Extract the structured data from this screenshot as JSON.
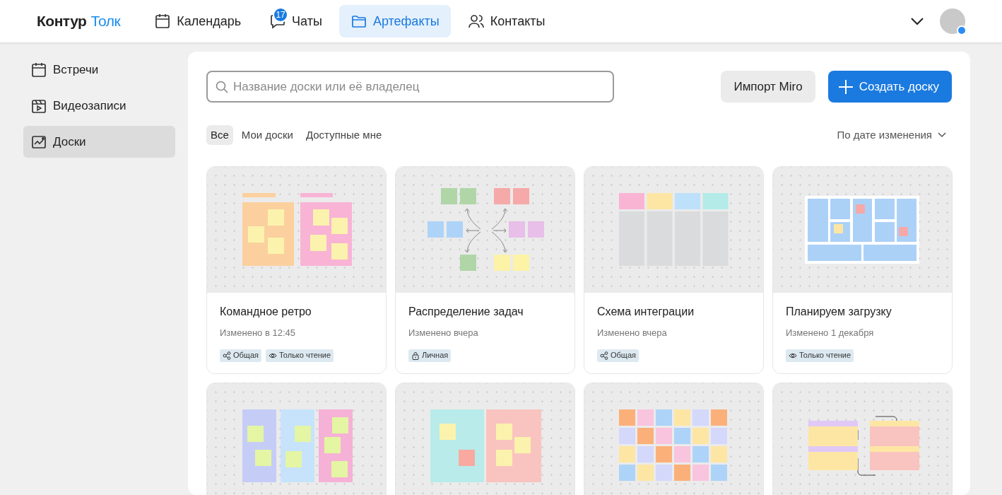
{
  "logo": {
    "brand": "Контур",
    "product": "Толк"
  },
  "nav": [
    {
      "kind": "calendar",
      "label": "Календарь",
      "selected": false
    },
    {
      "kind": "chat",
      "label": "Чаты",
      "selected": false,
      "badge": "17"
    },
    {
      "kind": "folder",
      "label": "Артефакты",
      "selected": true
    },
    {
      "kind": "people",
      "label": "Контакты",
      "selected": false
    }
  ],
  "avatar": {
    "online": true
  },
  "sidebar": {
    "items": [
      {
        "kind": "calendar",
        "label": "Встречи",
        "selected": false
      },
      {
        "kind": "video",
        "label": "Видеозаписи",
        "selected": false
      },
      {
        "kind": "board",
        "label": "Доски",
        "selected": true
      }
    ]
  },
  "search": {
    "placeholder": "Название доски или её владелец"
  },
  "buttons": [
    {
      "kind": "secondary",
      "label": "Импорт Miro"
    },
    {
      "kind": "primary",
      "label": "Создать доску"
    }
  ],
  "filters": [
    {
      "label": "Все",
      "selected": true
    },
    {
      "label": "Мои доски",
      "selected": false
    },
    {
      "label": "Доступные мне",
      "selected": false
    }
  ],
  "sort": {
    "label": "По дате изменения"
  },
  "cards": [
    {
      "kind": "retro",
      "title": "Командное ретро",
      "modified": "Изменено в 12:45",
      "tags": [
        {
          "kind": "shared",
          "label": "Общая"
        },
        {
          "kind": "readonly",
          "label": "Только чтение"
        }
      ]
    },
    {
      "kind": "mindmap",
      "title": "Распределение задач",
      "modified": "Изменено вчера",
      "tags": [
        {
          "kind": "private",
          "label": "Личная"
        }
      ]
    },
    {
      "kind": "kanban",
      "title": "Схема интеграции",
      "modified": "Изменено вчера",
      "tags": [
        {
          "kind": "shared",
          "label": "Общая"
        }
      ]
    },
    {
      "kind": "layout",
      "title": "Планируем загрузку",
      "modified": "Изменено 1 декабря",
      "tags": [
        {
          "kind": "readonly",
          "label": "Только чтение"
        }
      ]
    },
    {
      "kind": "columns"
    },
    {
      "kind": "areas"
    },
    {
      "kind": "grid"
    },
    {
      "kind": "lists"
    }
  ]
}
